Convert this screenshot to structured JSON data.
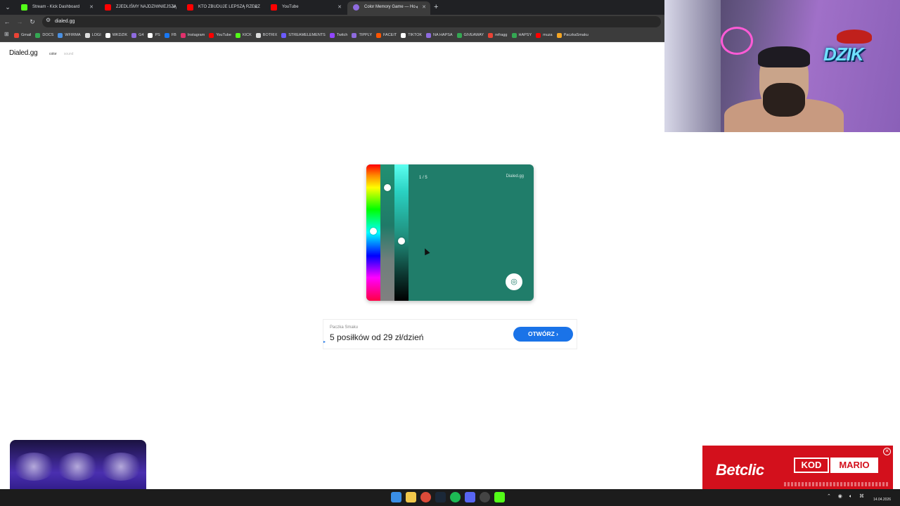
{
  "browser": {
    "tabs": [
      {
        "title": "Stream - Kick Dashboard",
        "color": "#53fc18",
        "active": false
      },
      {
        "title": "ZJEDLIŚMY NAJDZIWNIEJSZĄ",
        "color": "#ff0000",
        "active": false
      },
      {
        "title": "KTO ZBUDUJE LEPSZĄ RZECZ",
        "color": "#ff0000",
        "active": false
      },
      {
        "title": "YouTube",
        "color": "#ff0000",
        "active": false
      },
      {
        "title": "Color Memory Game — Ho",
        "color": "#8e6bdf",
        "active": true
      }
    ],
    "url": "dialed.gg",
    "bookmarks": [
      {
        "label": "Gmail",
        "color": "#ea4335"
      },
      {
        "label": "DOCS",
        "color": "#34a853"
      },
      {
        "label": "WFIRMA",
        "color": "#4a90e2"
      },
      {
        "label": "LOGI",
        "color": "#dddddd"
      },
      {
        "label": "WKDZIK",
        "color": "#ffffff"
      },
      {
        "label": "G4",
        "color": "#8e6bdf"
      },
      {
        "label": "PS",
        "color": "#ffffff"
      },
      {
        "label": "FB",
        "color": "#1877f2"
      },
      {
        "label": "Instagram",
        "color": "#e1306c"
      },
      {
        "label": "YouTube",
        "color": "#ff0000"
      },
      {
        "label": "KICK",
        "color": "#53fc18"
      },
      {
        "label": "BOTRIX",
        "color": "#dddddd"
      },
      {
        "label": "STREAMELEMENTS",
        "color": "#6b5bff"
      },
      {
        "label": "Twitch",
        "color": "#9146ff"
      },
      {
        "label": "TIPPLY",
        "color": "#8e6bdf"
      },
      {
        "label": "FACEIT",
        "color": "#ff5500"
      },
      {
        "label": "TIKTOK",
        "color": "#ffffff"
      },
      {
        "label": "NA HAPSA",
        "color": "#8e6bdf"
      },
      {
        "label": "GIVEAWAY",
        "color": "#34a853"
      },
      {
        "label": "refragg",
        "color": "#ea4335"
      },
      {
        "label": "HAPSY",
        "color": "#34a853"
      },
      {
        "label": "muza",
        "color": "#ff0000"
      },
      {
        "label": "PaczkaSmaku",
        "color": "#f5a623"
      }
    ]
  },
  "site": {
    "logo": "Dialed.gg",
    "nav": {
      "color": "color",
      "sound": "sound"
    }
  },
  "game": {
    "round": "1 / 5",
    "brand": "Dialed.gg",
    "color": "#207d6a",
    "hue_knob_fraction": 0.49,
    "lightness_knob_fraction": 0.56,
    "saturation_knob_fraction": 0.17
  },
  "ad": {
    "sponsor": "Paczka Smaku",
    "headline": "5 posiłków od 29 zł/dzień",
    "cta": "OTWÓRZ"
  },
  "overlay": {
    "webcam_brand": "DZIK",
    "betclic_logo": "Betclic",
    "kod_label": "KOD",
    "kod_value": "MARIO"
  },
  "taskbar": {
    "date": "14.04.2026"
  }
}
